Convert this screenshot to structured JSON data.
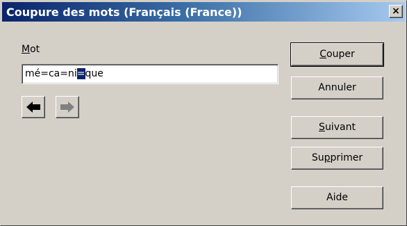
{
  "dialog": {
    "title": "Coupure des mots (Français (France))",
    "close_label": "×"
  },
  "word": {
    "label_accel": "M",
    "label_rest": "ot",
    "value_before": "mé=ca=ni",
    "value_cursor": "=",
    "value_after": "que"
  },
  "buttons": {
    "couper_accel": "C",
    "couper_rest": "ouper",
    "annuler": "Annuler",
    "suivant_accel": "S",
    "suivant_rest": "uivant",
    "supprimer_pre": "Su",
    "supprimer_accel": "p",
    "supprimer_rest": "primer",
    "aide": "Aide"
  },
  "icons": {
    "left": "arrow-left-icon",
    "right": "arrow-right-icon"
  },
  "colors": {
    "titlebar_start": "#0a246a",
    "titlebar_end": "#a6caf0",
    "face": "#d4d0c8"
  }
}
